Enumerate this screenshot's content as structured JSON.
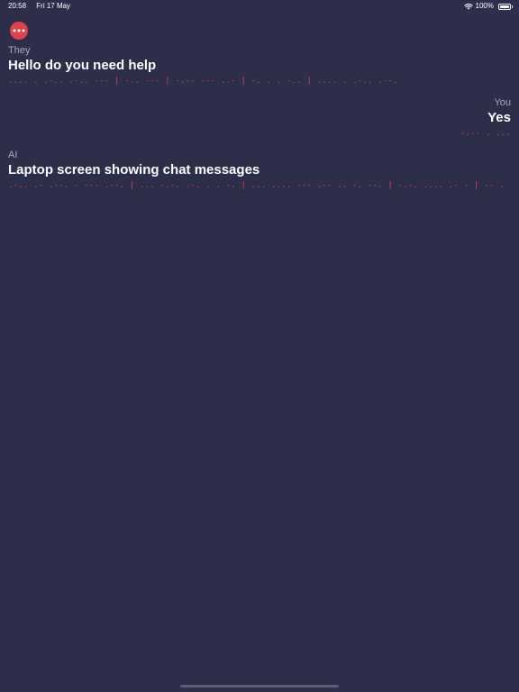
{
  "status_bar": {
    "time": "20:58",
    "date": "Fri 17 May",
    "battery": "100%",
    "wifi_icon": "wifi-icon",
    "battery_icon": "battery-icon"
  },
  "more_button": {
    "icon": "more-icon",
    "color": "#e0424b"
  },
  "messages": [
    {
      "speaker": "They",
      "text": "Hello do you need help",
      "morse": ".... . .-.. .-.. --- | -.. --- | -.-- --- ..- | -. . . -.. | .... . .-.. .--.",
      "align": "left"
    },
    {
      "speaker": "You",
      "text": "Yes",
      "morse": "-.-- . ...",
      "align": "right"
    },
    {
      "speaker": "AI",
      "text": "Laptop screen showing chat messages",
      "morse": ".-.. .- .--. - --- .--. | ... -.-. .-. . . -. | ... .... --- .-- .. -. --. | -.-. .... .- - | -- . ... ... .- --. . ...",
      "align": "left"
    }
  ],
  "colors": {
    "background": "#2d2e4a",
    "morse": "#d8434c",
    "speaker": "#a9aabb"
  }
}
